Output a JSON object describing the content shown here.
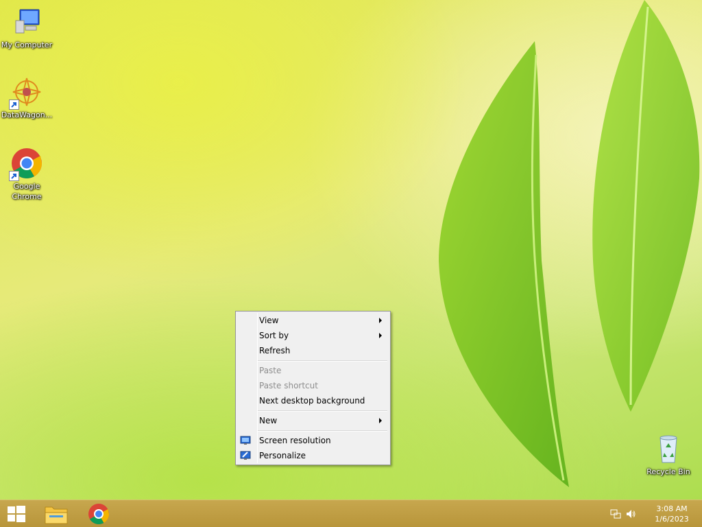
{
  "desktop": {
    "icons": [
      {
        "label": "My Computer",
        "icon": "computer-icon"
      },
      {
        "label": "DataWagon...",
        "icon": "datawagon-icon"
      },
      {
        "label": "Google Chrome",
        "icon": "chrome-icon"
      },
      {
        "label": "Recycle Bin",
        "icon": "recycle-bin-icon"
      }
    ]
  },
  "context_menu": {
    "items": [
      {
        "label": "View",
        "submenu": true,
        "enabled": true
      },
      {
        "label": "Sort by",
        "submenu": true,
        "enabled": true
      },
      {
        "label": "Refresh",
        "submenu": false,
        "enabled": true
      },
      {
        "label": "Paste",
        "submenu": false,
        "enabled": false
      },
      {
        "label": "Paste shortcut",
        "submenu": false,
        "enabled": false
      },
      {
        "label": "Next desktop background",
        "submenu": false,
        "enabled": true
      },
      {
        "label": "New",
        "submenu": true,
        "enabled": true
      },
      {
        "label": "Screen resolution",
        "submenu": false,
        "enabled": true,
        "icon": "screen-resolution-icon"
      },
      {
        "label": "Personalize",
        "submenu": false,
        "enabled": true,
        "icon": "personalize-icon"
      }
    ]
  },
  "taskbar": {
    "pinned": [
      {
        "name": "File Explorer",
        "icon": "file-explorer-icon"
      },
      {
        "name": "Google Chrome",
        "icon": "chrome-icon"
      }
    ],
    "tray_icons": [
      "network-icon",
      "volume-icon"
    ],
    "clock": {
      "time": "3:08 AM",
      "date": "1/6/2023"
    }
  },
  "colors": {
    "taskbar": "#bf9f45",
    "menu_bg": "#f0f0f0",
    "disabled_text": "#8d8d8d"
  }
}
